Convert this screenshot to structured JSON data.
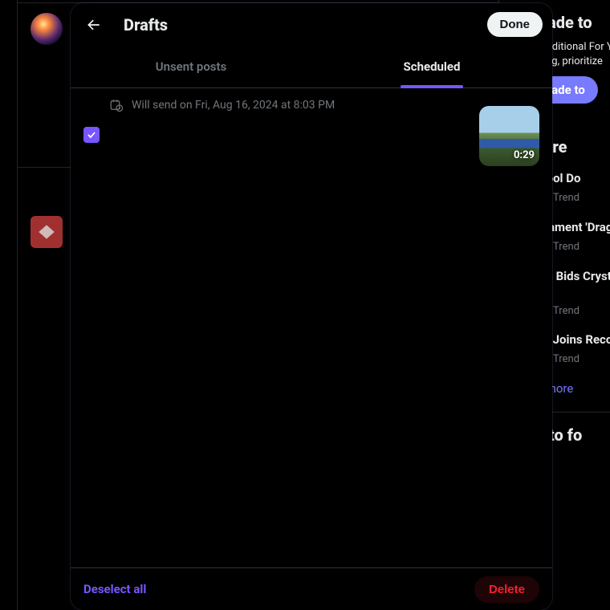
{
  "modal": {
    "title": "Drafts",
    "done_label": "Done",
    "tabs": {
      "unsent": "Unsent posts",
      "scheduled": "Scheduled"
    },
    "active_tab": "scheduled",
    "footer": {
      "deselect_label": "Deselect all",
      "delete_label": "Delete"
    }
  },
  "draft": {
    "schedule_text": "Will send on Fri, Aug 16, 2024 at 8:03 PM",
    "checked": true,
    "media_duration": "0:29"
  },
  "background": {
    "upgrade": {
      "title": "Upgrade to",
      "desc": "Enjoy additional For You and Following, prioritize",
      "cta": "Upgrade to"
    },
    "explore_heading": "Explore",
    "trends": [
      {
        "title": "Liverpool Do",
        "meta": "Trend",
        "faces": [
          "#c0504d",
          "#4f81bd",
          "#9bbb59"
        ]
      },
      {
        "title": "Fans Lament 'Dragon'",
        "meta": "Trend",
        "faces": [
          "#4f81bd",
          "#c0504d",
          "#4bacc6"
        ]
      },
      {
        "title": "Fulham Bids Crystal Palace",
        "meta": "Trend",
        "faces": [
          "#9bbb59",
          "#f79646",
          "#4f81bd"
        ]
      },
      {
        "title": "Blanke Joins Record Deal",
        "meta": "Trend",
        "faces": [
          "#4bacc6",
          "#9bbb59",
          "#c0504d"
        ]
      }
    ],
    "show_more": "Show more",
    "who_heading": "Who to fo"
  }
}
